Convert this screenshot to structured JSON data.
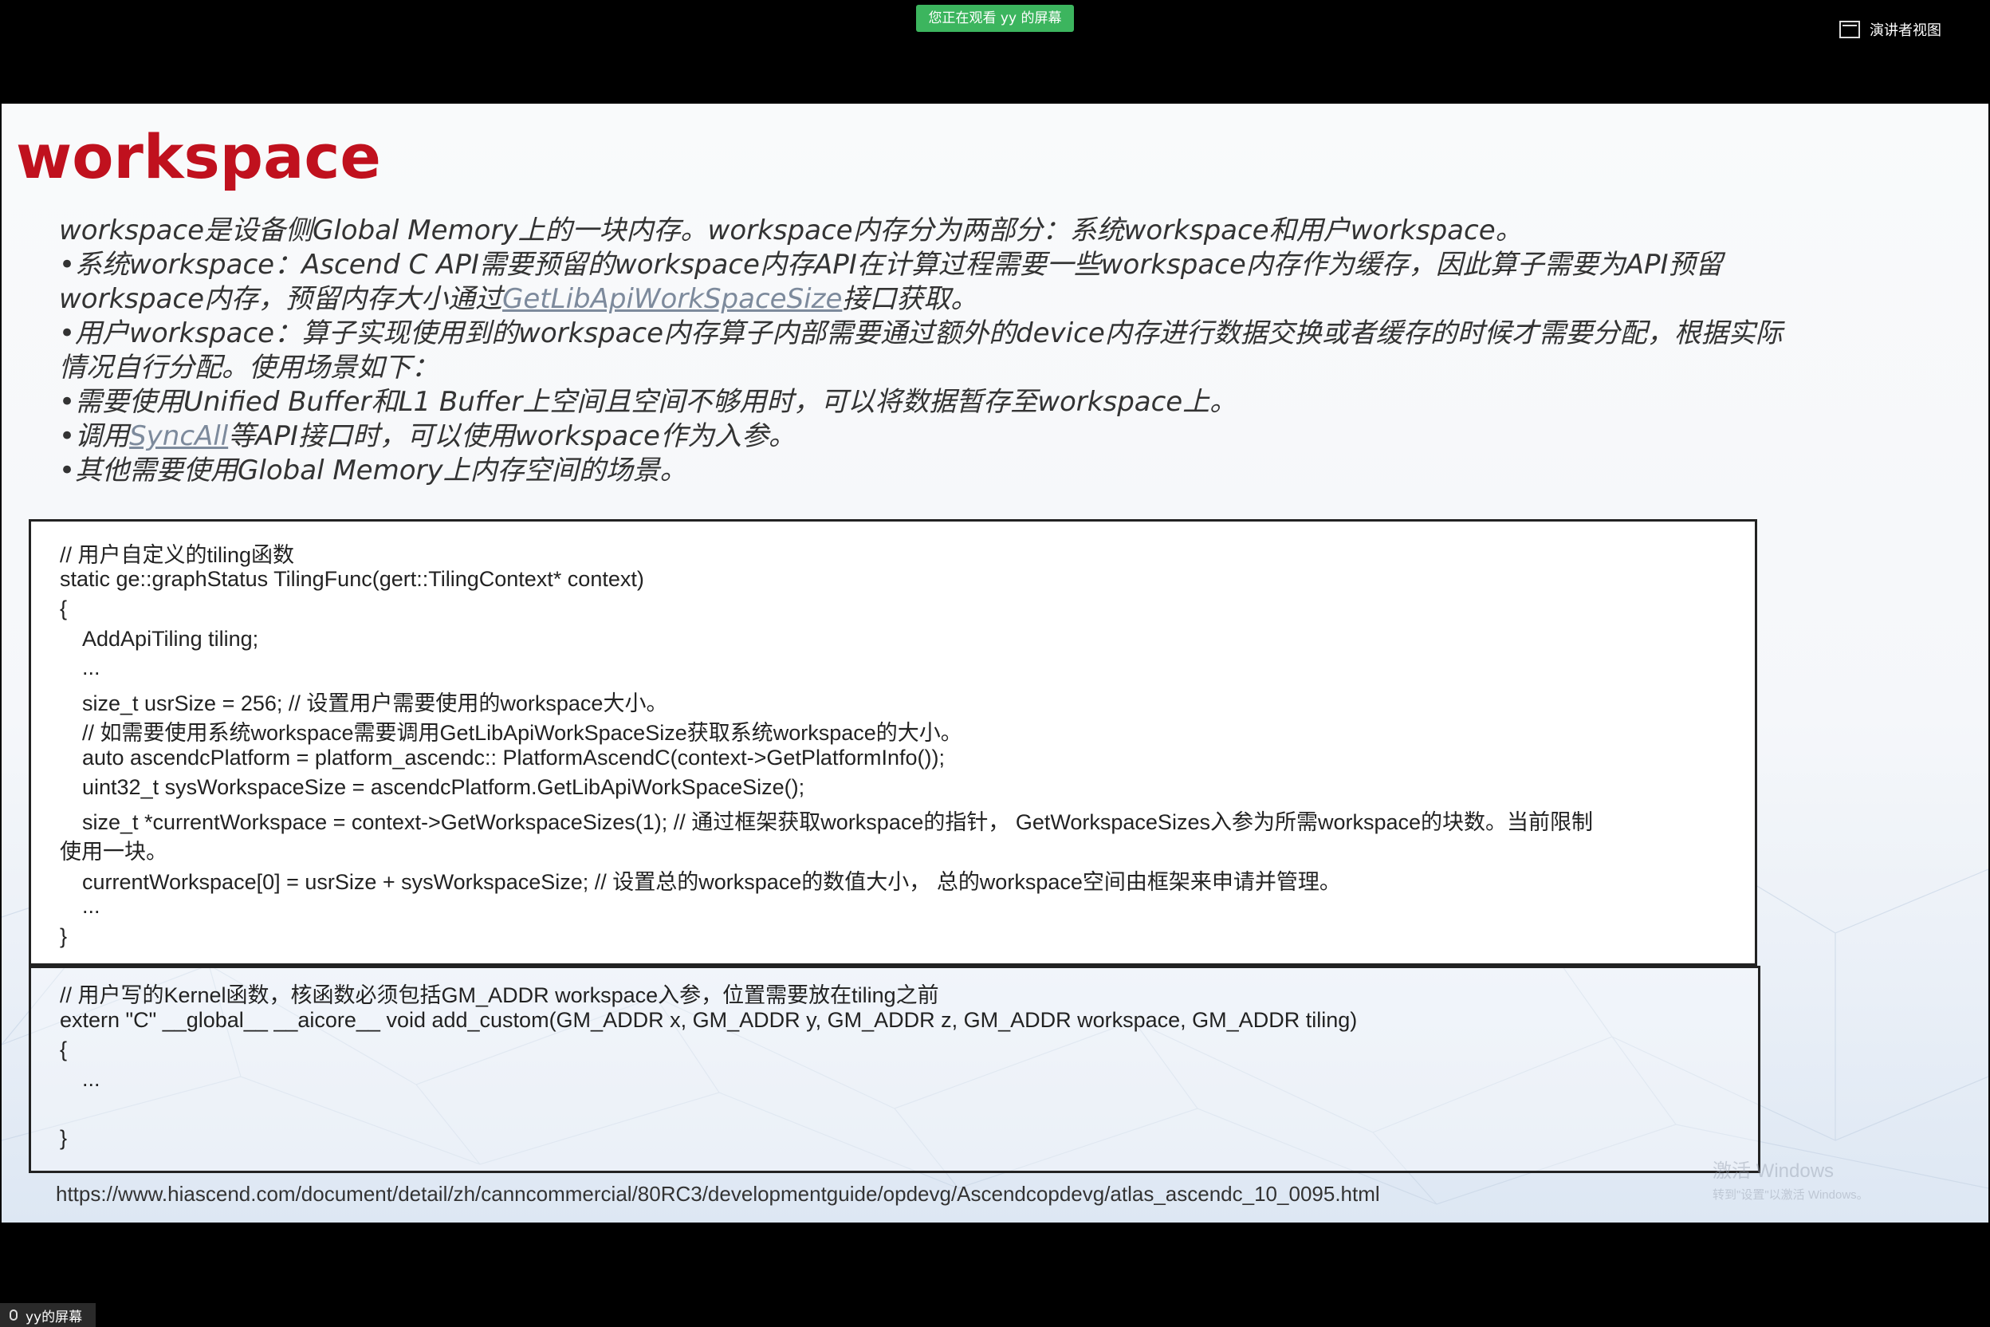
{
  "top_bar": {
    "share_banner": "您正在观看 yy 的屏幕",
    "presenter_view_label": "演讲者视图",
    "presenter_view_icon": "window-icon"
  },
  "slide": {
    "title": "workspace",
    "title_color": "#c0111e",
    "intro": {
      "line1": "workspace是设备侧Global Memory上的一块内存。workspace内存分为两部分：系统workspace和用户workspace。",
      "line2": "•系统workspace：Ascend C API需要预留的workspace内存API在计算过程需要一些workspace内存作为缓存，因此算子需要为API预留",
      "line3_pre": "workspace内存，预留内存大小通过",
      "line3_link": "GetLibApiWorkSpaceSize",
      "line3_post": "接口获取。",
      "line4": "•用户workspace：算子实现使用到的workspace内存算子内部需要通过额外的device内存进行数据交换或者缓存的时候才需要分配，根据实际",
      "line5": "情况自行分配。使用场景如下：",
      "line6": "•需要使用Unified Buffer和L1 Buffer上空间且空间不够用时，可以将数据暂存至workspace上。",
      "line7_pre": "•调用",
      "line7_link": "SyncAll",
      "line7_post": "等API接口时，可以使用workspace作为入参。",
      "line8": "•其他需要使用Global Memory上内存空间的场景。"
    },
    "code1": {
      "l1": "// 用户自定义的tiling函数",
      "l2": "static ge::graphStatus TilingFunc(gert::TilingContext* context)",
      "l3": "{",
      "l4": "AddApiTiling tiling;",
      "l5": "...",
      "l6": "size_t usrSize = 256; // 设置用户需要使用的workspace大小。",
      "l7": "// 如需要使用系统workspace需要调用GetLibApiWorkSpaceSize获取系统workspace的大小。",
      "l8": "auto ascendcPlatform = platform_ascendc:: PlatformAscendC(context->GetPlatformInfo());",
      "l9": "uint32_t sysWorkspaceSize = ascendcPlatform.GetLibApiWorkSpaceSize();",
      "l10": "size_t *currentWorkspace = context->GetWorkspaceSizes(1); // 通过框架获取workspace的指针， GetWorkspaceSizes入参为所需workspace的块数。当前限制",
      "l11": "使用一块。",
      "l12": "currentWorkspace[0] = usrSize + sysWorkspaceSize; // 设置总的workspace的数值大小， 总的workspace空间由框架来申请并管理。",
      "l13": "...",
      "l14": "}"
    },
    "code2": {
      "l1": "// 用户写的Kernel函数，核函数必须包括GM_ADDR workspace入参，位置需要放在tiling之前",
      "l2": "extern \"C\" __global__ __aicore__ void add_custom(GM_ADDR x, GM_ADDR y, GM_ADDR z, GM_ADDR workspace, GM_ADDR tiling)",
      "l3": "{",
      "l4": "...",
      "l5": "}"
    },
    "url": "https://www.hiascend.com/document/detail/zh/canncommercial/80RC3/developmentguide/opdevg/Ascendcopdevg/atlas_ascendc_10_0095.html",
    "watermark_title": "激活 Windows",
    "watermark_sub": "转到\"设置\"以激活 Windows。"
  },
  "bottom_tag": {
    "label": "yy的屏幕",
    "icon": "microphone-icon"
  }
}
